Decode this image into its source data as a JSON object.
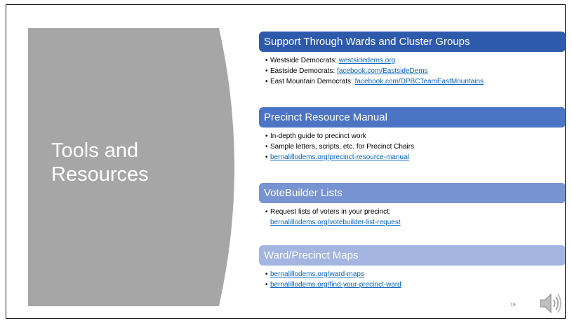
{
  "slide": {
    "title": "Tools and Resources",
    "page_number": "19",
    "panel_color": "#a6a6a6",
    "link_color": "#0563c1",
    "audio_icon": "speaker-icon"
  },
  "sections": [
    {
      "header": "Support Through Wards and Cluster Groups",
      "color": "#2e5aac",
      "items": [
        {
          "text": "Westside Democrats: ",
          "link": "westsidedems.org"
        },
        {
          "text": "Eastside Democrats: ",
          "link": "facebook.com/EastsideDems"
        },
        {
          "text": "East Mountain Democrats: ",
          "link": "facebook.com/DPBCTeamEastMountains"
        }
      ]
    },
    {
      "header": "Precinct Resource Manual",
      "color": "#4c74c4",
      "items": [
        {
          "text": "In-depth guide to precinct work",
          "link": ""
        },
        {
          "text": "Sample letters, scripts, etc. for Precinct Chairs",
          "link": ""
        },
        {
          "text": "",
          "link": "bernalillodems.org/precinct-resource-manual"
        }
      ]
    },
    {
      "header": "VoteBuilder Lists",
      "color": "#7893d2",
      "items": [
        {
          "text": "Request lists of voters in your precinct:",
          "link": "bernalillodems.org/votebuilder-list-request"
        }
      ]
    },
    {
      "header": "Ward/Precinct Maps",
      "color": "#a3b5e0",
      "items": [
        {
          "text": "",
          "link": "bernalillodems.org/ward-maps"
        },
        {
          "text": "",
          "link": "bernalillodems.org/find-your-precinct-ward"
        }
      ]
    }
  ]
}
